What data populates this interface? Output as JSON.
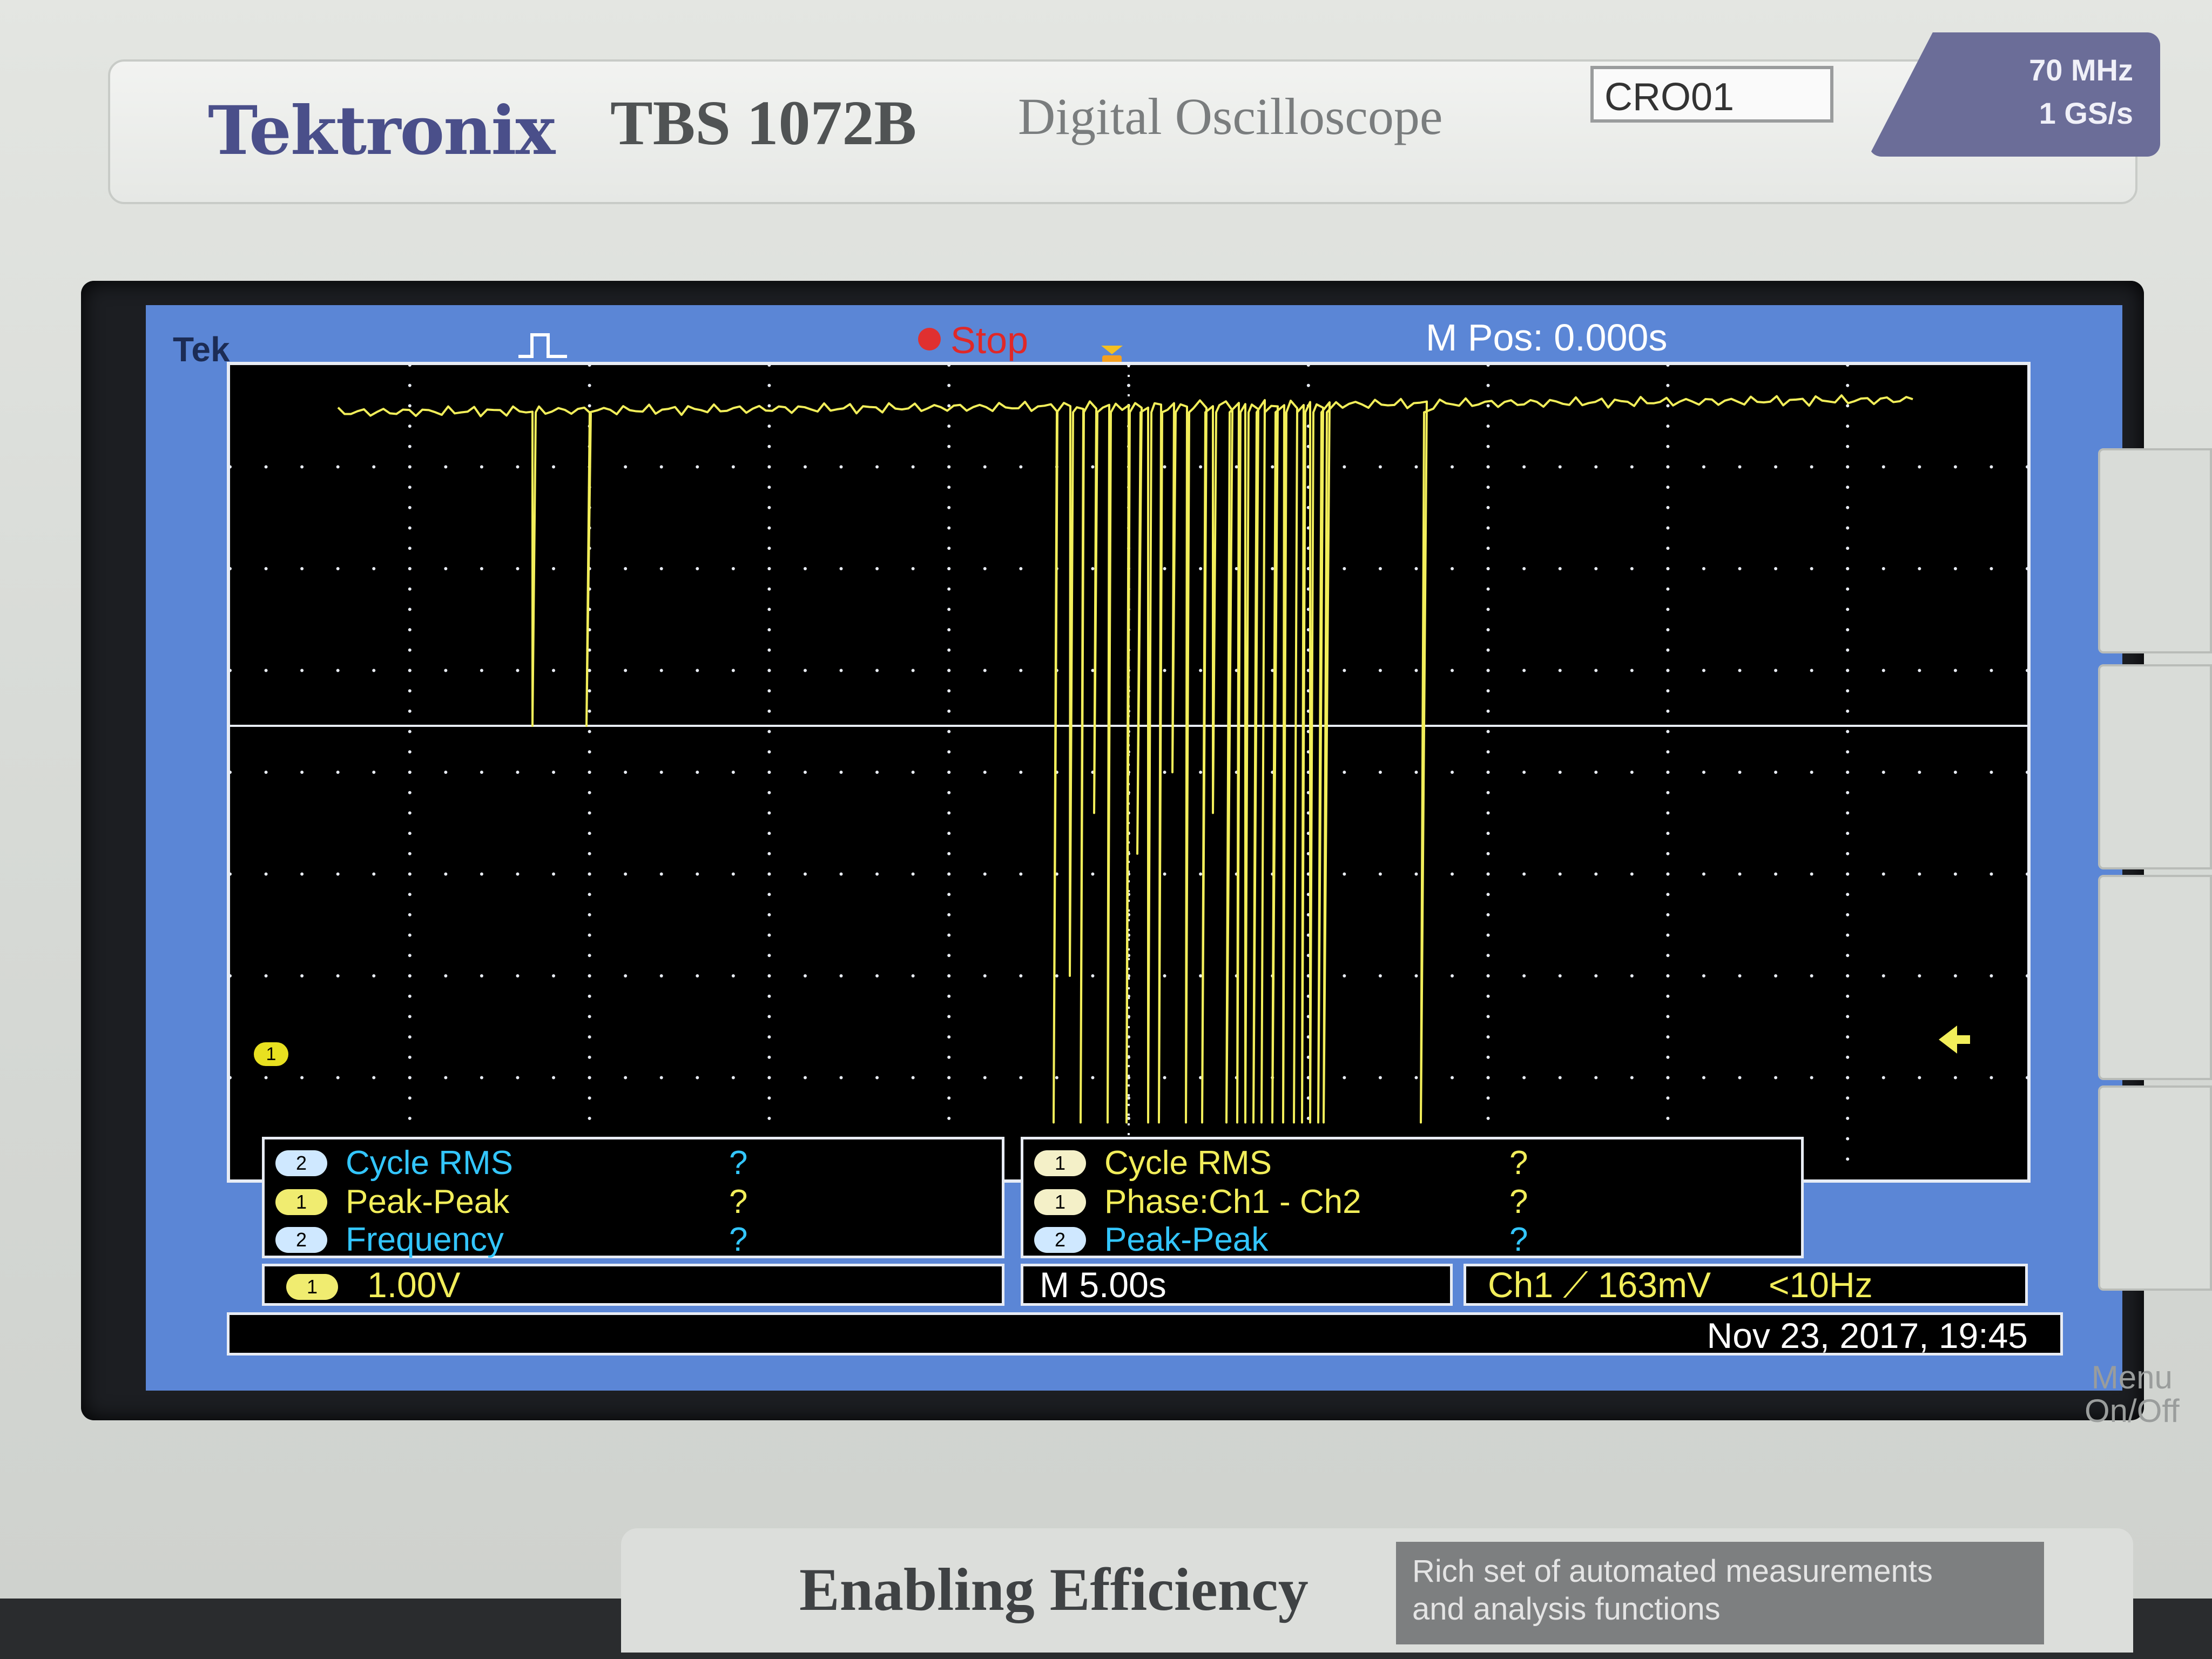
{
  "device": {
    "brand": "Tektronix",
    "model": "TBS 1072B",
    "description": "Digital Oscilloscope",
    "asset_tag": "CRO01",
    "spec_bandwidth": "70 MHz",
    "spec_sample_rate": "1 GS/s",
    "slogan": "Enabling Efficiency",
    "footer_note_line1": "Rich set of automated measurements",
    "footer_note_line2": "and analysis functions",
    "menu_button_line1": "Menu",
    "menu_button_line2": "On/Off"
  },
  "screen": {
    "tek_label": "Tek",
    "acq_status": "Stop",
    "m_pos": "M Pos: 0.000s",
    "ch1_marker": "1",
    "trace_color": "#f2ee5a",
    "grid_color": "#e8ecf4"
  },
  "measurements_left": [
    {
      "channel": "2",
      "label": "Cycle RMS",
      "value": "?",
      "color": "blue"
    },
    {
      "channel": "1",
      "label": "Peak-Peak",
      "value": "?",
      "color": "yellow"
    },
    {
      "channel": "2",
      "label": "Frequency",
      "value": "?",
      "color": "blue"
    }
  ],
  "measurements_right": [
    {
      "channel": "1",
      "label": "Cycle RMS",
      "value": "?",
      "color": "yellow"
    },
    {
      "channel": "1",
      "label": "Phase:Ch1 - Ch2",
      "value": "?",
      "color": "yellow"
    },
    {
      "channel": "2",
      "label": "Peak-Peak",
      "value": "?",
      "color": "blue"
    }
  ],
  "status": {
    "ch1_badge": "1",
    "ch1_scale": "1.00V",
    "time_scale": "M 5.00s",
    "trigger": "Ch1 ⟋ 163mV",
    "trigger_freq": "<10Hz",
    "datetime": "Nov 23, 2017, 19:45"
  }
}
